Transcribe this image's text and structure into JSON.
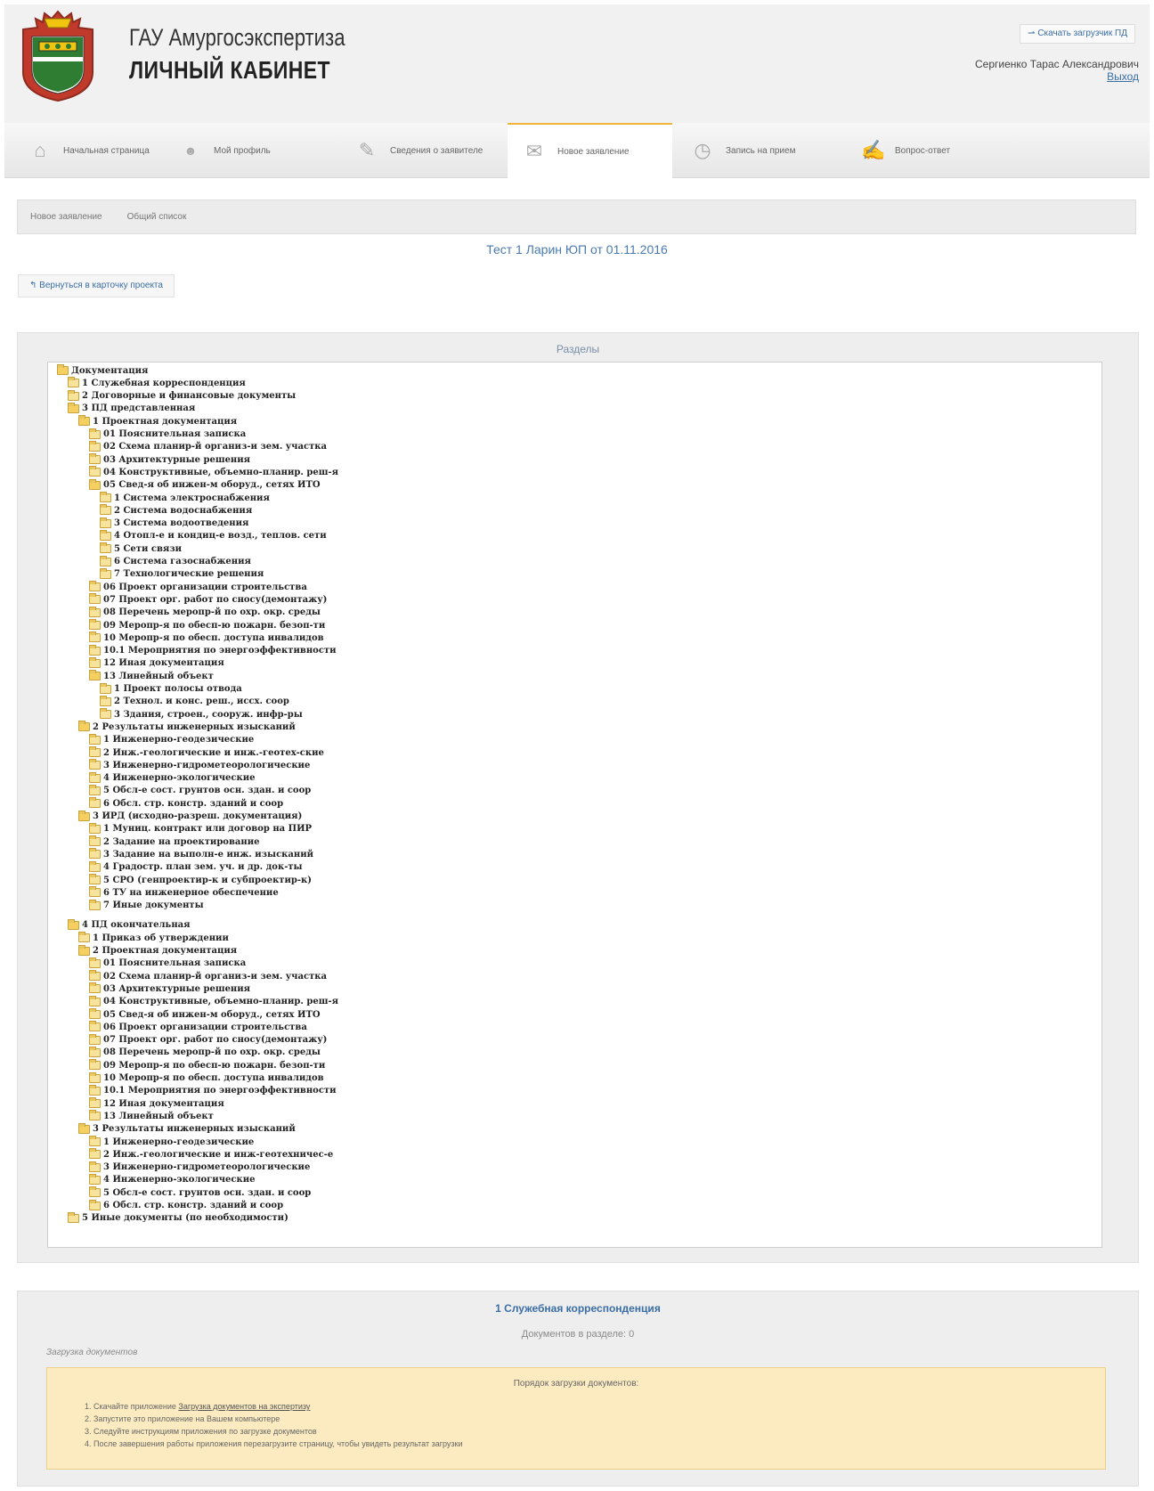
{
  "header": {
    "org_name": "ГАУ Амургосэкспертиза",
    "cabinet_label": "ЛИЧНЫЙ КАБИНЕТ",
    "download_button": "Скачать загрузчик ПД",
    "user_name": "Сергиенко Тарас Александрович",
    "logout": "Выход"
  },
  "nav": [
    {
      "label": "Начальная страница",
      "icon": "home-icon"
    },
    {
      "label": "Мой профиль",
      "icon": "profile-icon"
    },
    {
      "label": "Сведения о заявителе",
      "icon": "edit-icon"
    },
    {
      "label": "Новое заявление",
      "icon": "mail-icon",
      "active": true
    },
    {
      "label": "Запись на прием",
      "icon": "clock-icon"
    },
    {
      "label": "Вопрос-ответ",
      "icon": "chat-icon"
    }
  ],
  "subtabs": [
    "Новое заявление",
    "Общий список"
  ],
  "project_title": "Тест 1 Ларин ЮП от 01.11.2016",
  "back_button": "Вернуться в карточку проекта",
  "sections_title": "Разделы",
  "tree": [
    {
      "label": "Документация",
      "depth": 0,
      "open": true
    },
    {
      "label": "1 Служебная корреспонденция",
      "depth": 1
    },
    {
      "label": "2 Договорные и финансовые документы",
      "depth": 1
    },
    {
      "label": "3 ПД представленная",
      "depth": 1,
      "open": true
    },
    {
      "label": "1 Проектная документация",
      "depth": 2,
      "open": true
    },
    {
      "label": "01 Пояснительная записка",
      "depth": 3
    },
    {
      "label": "02 Схема планир-й организ-и зем. участка",
      "depth": 3
    },
    {
      "label": "03 Архитектурные решения",
      "depth": 3
    },
    {
      "label": "04 Конструктивные, объемно-планир. реш-я",
      "depth": 3
    },
    {
      "label": "05 Свед-я об инжен-м оборуд., сетях ИТО",
      "depth": 3,
      "open": true
    },
    {
      "label": "1 Система электроснабжения",
      "depth": 4
    },
    {
      "label": "2 Система водоснабжения",
      "depth": 4
    },
    {
      "label": "3 Система водоотведения",
      "depth": 4
    },
    {
      "label": "4 Отопл-е и кондиц-е возд., теплов. сети",
      "depth": 4
    },
    {
      "label": "5 Сети связи",
      "depth": 4
    },
    {
      "label": "6 Система газоснабжения",
      "depth": 4
    },
    {
      "label": "7 Технологические решения",
      "depth": 4
    },
    {
      "label": "06 Проект организации строительства",
      "depth": 3
    },
    {
      "label": "07 Проект орг. работ по сносу(демонтажу)",
      "depth": 3
    },
    {
      "label": "08 Перечень меропр-й по охр. окр. среды",
      "depth": 3
    },
    {
      "label": "09 Меропр-я по обесп-ю пожарн. безоп-ти",
      "depth": 3
    },
    {
      "label": "10 Меропр-я по обесп. доступа инвалидов",
      "depth": 3
    },
    {
      "label": "10.1 Мероприятия по энергоэффективности",
      "depth": 3
    },
    {
      "label": "12 Иная документация",
      "depth": 3
    },
    {
      "label": "13 Линейный объект",
      "depth": 3,
      "open": true
    },
    {
      "label": "1 Проект полосы отвода",
      "depth": 4
    },
    {
      "label": "2 Технол. и конс. реш., иссх. соор",
      "depth": 4
    },
    {
      "label": "3 Здания, строен., сооруж. инфр-ры",
      "depth": 4
    },
    {
      "label": "2 Результаты инженерных изысканий",
      "depth": 2,
      "open": true
    },
    {
      "label": "1 Инженерно-геодезические",
      "depth": 3
    },
    {
      "label": "2 Инж.-геологические и инж.-геотех-ские",
      "depth": 3
    },
    {
      "label": "3 Инженерно-гидрометеорологические",
      "depth": 3
    },
    {
      "label": "4 Инженерно-экологические",
      "depth": 3
    },
    {
      "label": "5 Обсл-е сост. грунтов осн. здан. и соор",
      "depth": 3
    },
    {
      "label": "6 Обсл. стр. констр. зданий и соор",
      "depth": 3
    },
    {
      "label": "3 ИРД (исходно-разреш. документация)",
      "depth": 2,
      "open": true
    },
    {
      "label": "1 Муниц. контракт или договор на ПИР",
      "depth": 3
    },
    {
      "label": "2 Задание на проектирование",
      "depth": 3
    },
    {
      "label": "3 Задание на выполн-е инж. изысканий",
      "depth": 3
    },
    {
      "label": "4 Градостр. план зем. уч. и др. док-ты",
      "depth": 3
    },
    {
      "label": "5 СРО (генпроектир-к и субпроектир-к)",
      "depth": 3
    },
    {
      "label": "6 ТУ на инженерное обеспечение",
      "depth": 3
    },
    {
      "label": "7 Иные документы",
      "depth": 3
    },
    {
      "label": "4 ПД окончательная",
      "depth": 1,
      "open": true
    },
    {
      "label": "1 Приказ об утверждении",
      "depth": 2
    },
    {
      "label": "2 Проектная документация",
      "depth": 2,
      "open": true
    },
    {
      "label": "01 Пояснительная записка",
      "depth": 3
    },
    {
      "label": "02 Схема планир-й организ-и зем. участка",
      "depth": 3
    },
    {
      "label": "03 Архитектурные решения",
      "depth": 3
    },
    {
      "label": "04 Конструктивные, объемно-планир. реш-я",
      "depth": 3
    },
    {
      "label": "05 Свед-я об инжен-м оборуд., сетях ИТО",
      "depth": 3
    },
    {
      "label": "06 Проект организации строительства",
      "depth": 3
    },
    {
      "label": "07 Проект орг. работ по сносу(демонтажу)",
      "depth": 3
    },
    {
      "label": "08 Перечень меропр-й по охр. окр. среды",
      "depth": 3
    },
    {
      "label": "09 Меропр-я по обесп-ю пожарн. безоп-ти",
      "depth": 3
    },
    {
      "label": "10 Меропр-я по обесп. доступа инвалидов",
      "depth": 3
    },
    {
      "label": "10.1 Мероприятия по энергоэффективности",
      "depth": 3
    },
    {
      "label": "12 Иная документация",
      "depth": 3
    },
    {
      "label": "13 Линейный объект",
      "depth": 3
    },
    {
      "label": "3 Результаты инженерных изысканий",
      "depth": 2,
      "open": true
    },
    {
      "label": "1 Инженерно-геодезические",
      "depth": 3
    },
    {
      "label": "2 Инж.-геологические и инж-геотехничес-е",
      "depth": 3
    },
    {
      "label": "3 Инженерно-гидрометеорологические",
      "depth": 3
    },
    {
      "label": "4 Инженерно-экологические",
      "depth": 3
    },
    {
      "label": "5 Обсл-е сост. грунтов осн. здан. и соор",
      "depth": 3
    },
    {
      "label": "6 Обсл. стр. констр. зданий и соор",
      "depth": 3
    },
    {
      "label": "5 Иные документы (по необходимости)",
      "depth": 1
    }
  ],
  "selected_section": {
    "title": "1 Служебная корреспонденция",
    "doc_count": "Документов в разделе: 0",
    "upload_label": "Загрузка документов",
    "instructions_title": "Порядок загрузки документов:",
    "steps": [
      {
        "prefix": "Скачайте приложение ",
        "link": "Загрузка документов на экспертизу"
      },
      {
        "prefix": "Запустите это приложение на Вашем компьютере",
        "link": ""
      },
      {
        "prefix": "Следуйте инструкциям приложения по загрузке документов",
        "link": ""
      },
      {
        "prefix": "После завершения работы приложения перезагрузите страницу, чтобы увидеть результат загрузки",
        "link": ""
      }
    ]
  }
}
